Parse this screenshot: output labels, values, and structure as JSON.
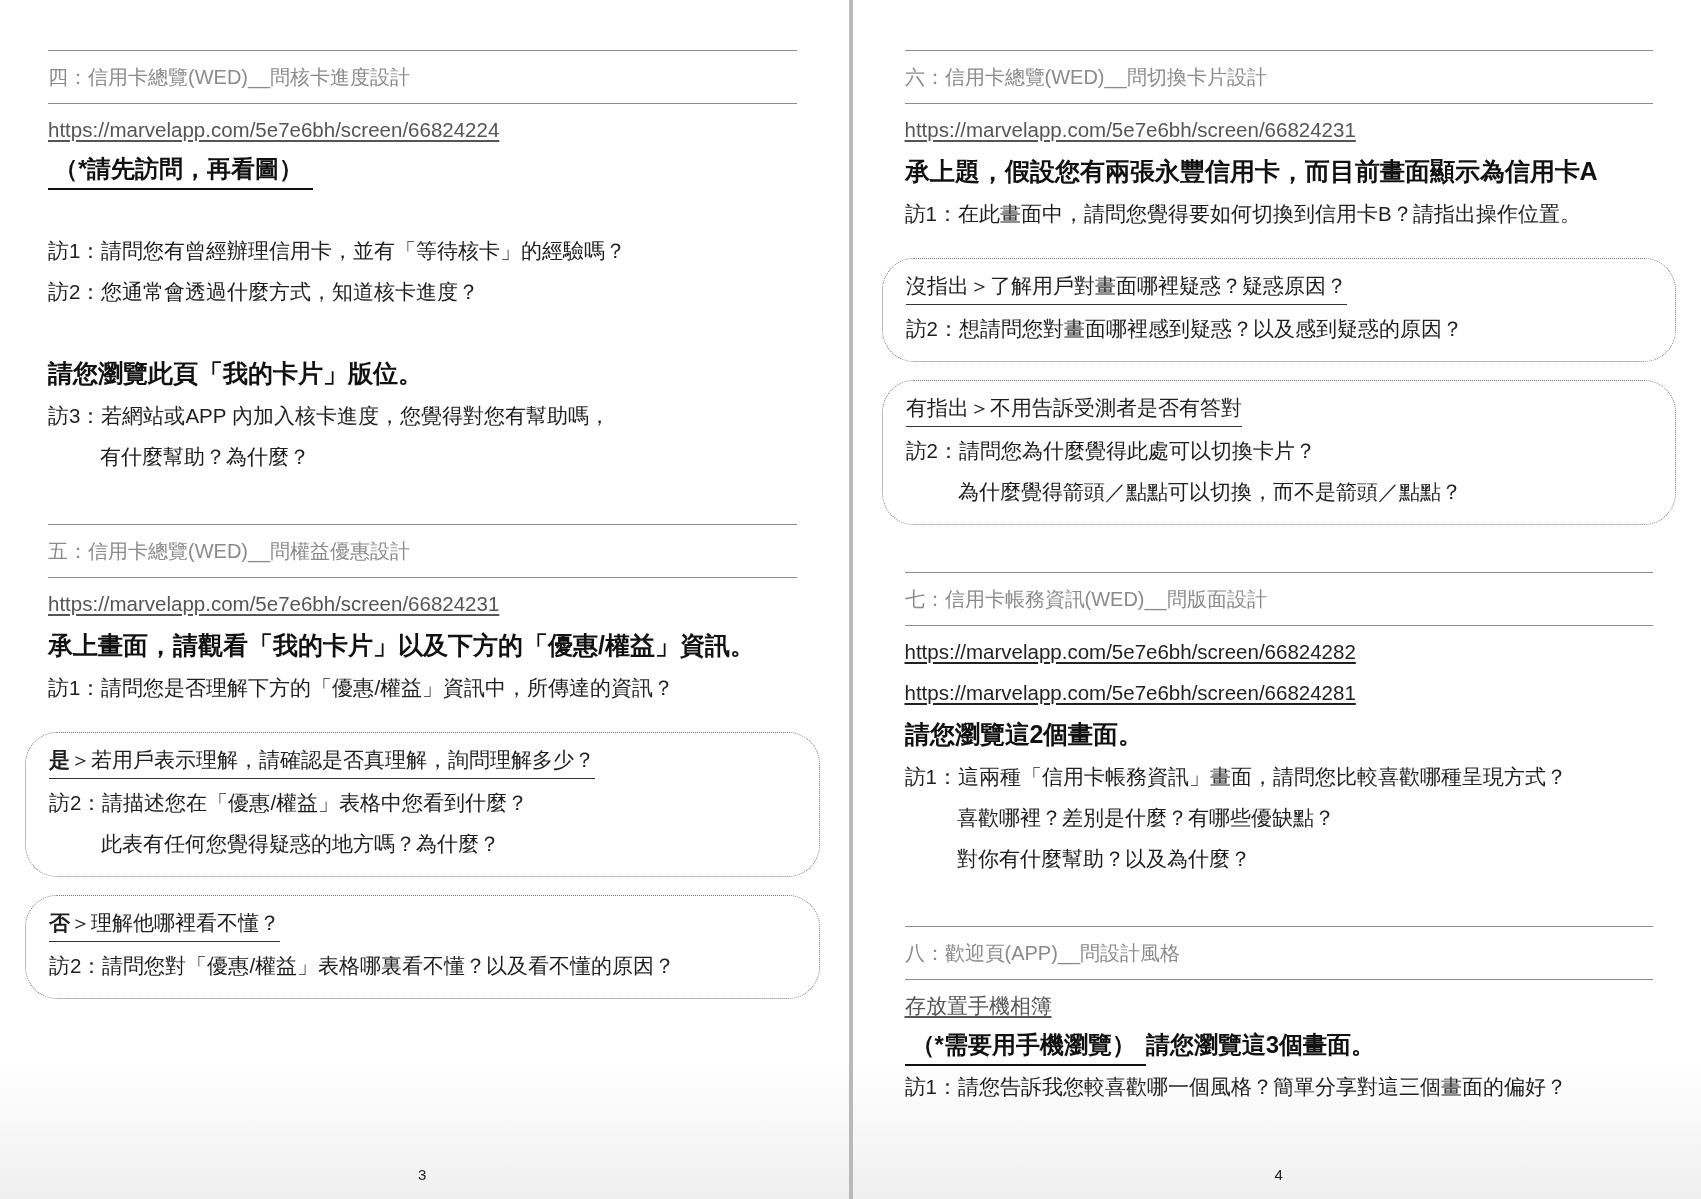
{
  "pages": [
    {
      "number": "3",
      "sections": [
        {
          "heading": "四：信用卡總覽(WED)__問核卡進度設計",
          "groups": [
            [
              {
                "kind": "link",
                "text": "https://marvelapp.com/5e7e6bh/screen/66824224",
                "muted": true
              },
              {
                "kind": "note",
                "underlined": "（*請先訪問，再看圖）"
              }
            ],
            [
              {
                "kind": "question",
                "lines": [
                  "訪1：請問您有曾經辦理信用卡，並有「等待核卡」的經驗嗎？"
                ]
              },
              {
                "kind": "question",
                "lines": [
                  "訪2：您通常會透過什麼方式，知道核卡進度？"
                ]
              }
            ],
            [
              {
                "kind": "lead",
                "text": "請您瀏覽此頁「我的卡片」版位。"
              },
              {
                "kind": "question",
                "lines": [
                  "訪3：若網站或APP 內加入核卡進度，您覺得對您有幫助嗎，",
                  "有什麼幫助？為什麼？"
                ]
              }
            ]
          ]
        },
        {
          "heading": "五：信用卡總覽(WED)__問權益優惠設計",
          "groups": [
            [
              {
                "kind": "link",
                "text": "https://marvelapp.com/5e7e6bh/screen/66824231",
                "muted": true
              },
              {
                "kind": "lead",
                "text": "承上畫面，請觀看「我的卡片」以及下方的「優惠/權益」資訊。"
              },
              {
                "kind": "question",
                "lines": [
                  "訪1：請問您是否理解下方的「優惠/權益」資訊中，所傳達的資訊？"
                ]
              },
              {
                "kind": "box",
                "label": "**是**＞若用戶表示理解，請確認是否真理解，詢問理解多少？",
                "lines": [
                  "訪2：請描述您在「優惠/權益」表格中您看到什麼？",
                  "此表有任何您覺得疑惑的地方嗎？為什麼？"
                ]
              },
              {
                "kind": "box",
                "label": "**否**＞理解他哪裡看不懂？",
                "lines": [
                  "訪2：請問您對「優惠/權益」表格哪裏看不懂？以及看不懂的原因？"
                ]
              }
            ]
          ]
        }
      ]
    },
    {
      "number": "4",
      "sections": [
        {
          "heading": "六：信用卡總覽(WED)__問切換卡片設計",
          "groups": [
            [
              {
                "kind": "link",
                "text": "https://marvelapp.com/5e7e6bh/screen/66824231",
                "muted": true
              },
              {
                "kind": "lead",
                "text": "承上題，假設您有兩張永豐信用卡，而目前畫面顯示為信用卡A"
              },
              {
                "kind": "question",
                "lines": [
                  "訪1：在此畫面中，請問您覺得要如何切換到信用卡B？請指出操作位置。"
                ]
              },
              {
                "kind": "box",
                "label": "沒指出＞了解用戶對畫面哪裡疑惑？疑惑原因？",
                "lines": [
                  "訪2：想請問您對畫面哪裡感到疑惑？以及感到疑惑的原因？"
                ]
              },
              {
                "kind": "box",
                "label": "有指出＞不用告訴受測者是否有答對",
                "lines": [
                  "訪2：請問您為什麼覺得此處可以切換卡片？",
                  "為什麼覺得箭頭／點點可以切換，而不是箭頭／點點？"
                ]
              }
            ]
          ]
        },
        {
          "heading": "七：信用卡帳務資訊(WED)__問版面設計",
          "groups": [
            [
              {
                "kind": "link",
                "text": "https://marvelapp.com/5e7e6bh/screen/66824282",
                "muted": false
              },
              {
                "kind": "link",
                "text": "https://marvelapp.com/5e7e6bh/screen/66824281",
                "muted": false
              },
              {
                "kind": "lead",
                "text": "請您瀏覽這2個畫面。"
              },
              {
                "kind": "question",
                "lines": [
                  "訪1：這兩種「信用卡帳務資訊」畫面，請問您比較喜歡哪種呈現方式？",
                  "喜歡哪裡？差別是什麼？有哪些優缺點？",
                  "對你有什麼幫助？以及為什麼？"
                ]
              }
            ]
          ]
        },
        {
          "heading": "八：歡迎頁(APP)__問設計風格",
          "groups": [
            [
              {
                "kind": "link",
                "text": "存放置手機相簿",
                "muted": true
              },
              {
                "kind": "note",
                "underlined": "（*需要用手機瀏覽）",
                "rest": "請您瀏覽這3個畫面。"
              },
              {
                "kind": "question",
                "lines": [
                  "訪1：請您告訴我您較喜歡哪一個風格？簡單分享對這三個畫面的偏好？"
                ]
              }
            ]
          ]
        }
      ]
    }
  ]
}
